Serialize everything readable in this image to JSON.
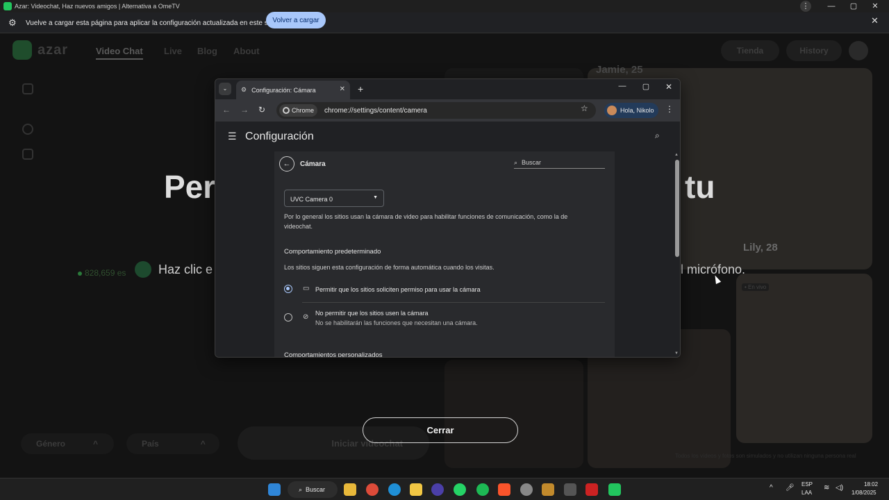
{
  "window": {
    "title": "Azar: Videochat, Haz nuevos amigos | Alternativa a OmeTV",
    "controls": [
      "—",
      "▢",
      "✕"
    ]
  },
  "infobar": {
    "text": "Vuelve a cargar esta página para aplicar la configuración actualizada en este sitio",
    "button": "Volver a cargar"
  },
  "site": {
    "brand": "azar",
    "nav": [
      "Video Chat",
      "Live",
      "Blog",
      "About"
    ],
    "tienda": "Tienda",
    "history": "History",
    "hero_left": "Per",
    "hero_right": "tu",
    "sub_left": "Haz clic e",
    "sub_right": "l micrófono.",
    "online": "828,659 es",
    "photo_top_name": "Jamie, 25",
    "photo_name": "Lily, 28",
    "badge": "• En vivo",
    "footnote": "Todos los vídeos y fotos son simulados y no utilizan ninguna persona real",
    "gender": "Género",
    "country": "País",
    "start": "Iniciar videochat",
    "close": "Cerrar"
  },
  "chrome": {
    "tab_title": "Configuración: Cámara",
    "chip": "Chrome",
    "url": "chrome://settings/content/camera",
    "profile": "Hola, Nikolo",
    "settings_title": "Configuración",
    "page_title": "Cámara",
    "search_placeholder": "Buscar",
    "camera_select": "UVC Camera 0",
    "description": "Por lo general los sitios usan la cámara de video para habilitar funciones de comunicación, como la de videochat.",
    "default_behavior": "Comportamiento predeterminado",
    "default_behavior_desc": "Los sitios siguen esta configuración de forma automática cuando los visitas.",
    "option_allow": "Permitir que los sitios soliciten permiso para usar la cámara",
    "option_block": "No permitir que los sitios usen la cámara",
    "option_block_sub": "No se habilitarán las funciones que necesitan una cámara.",
    "custom_behaviors": "Comportamientos personalizados",
    "selected_option": "allow"
  },
  "taskbar": {
    "search": "Buscar",
    "lang": "ESP",
    "layout": "LAA",
    "time": "18:02",
    "date": "1/08/2025"
  },
  "colors": {
    "accent": "#a8c7fa",
    "brand_green": "#22c55e"
  }
}
